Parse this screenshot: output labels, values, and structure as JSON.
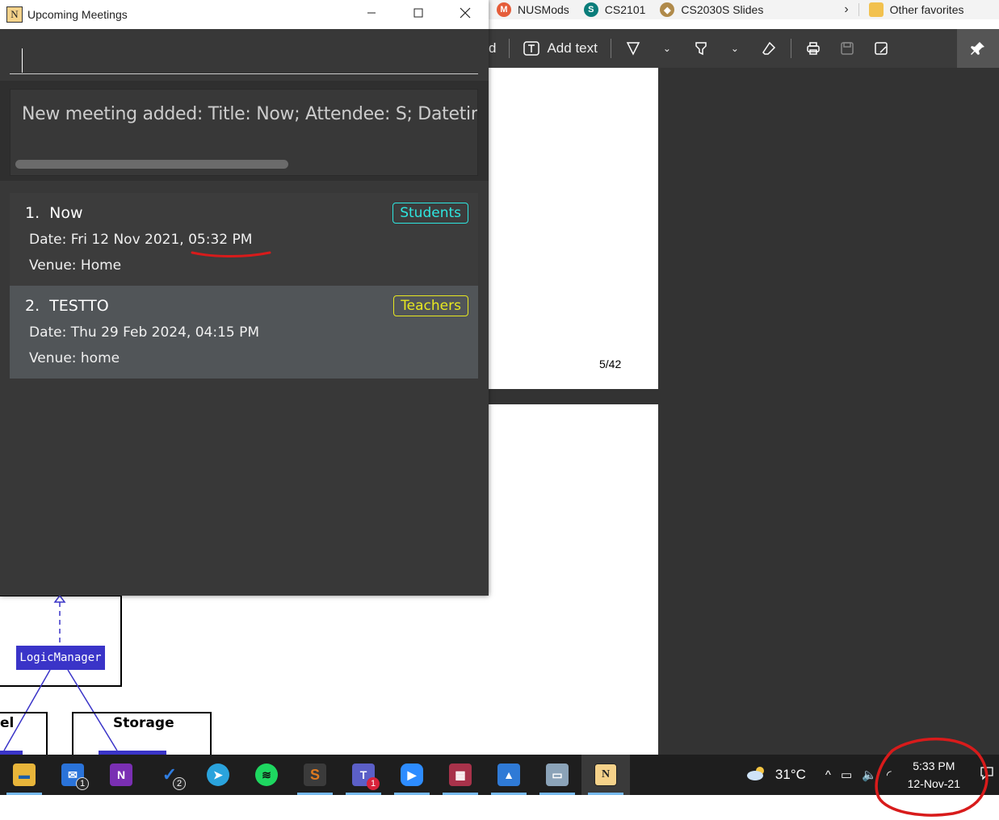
{
  "bookmarks": [
    {
      "label": "NUSMods",
      "icon": "nusmods-icon",
      "color": "#e55d3a",
      "glyph": "M"
    },
    {
      "label": "CS2101",
      "icon": "sharepoint-icon",
      "color": "#0a7d7a",
      "glyph": "S"
    },
    {
      "label": "CS2030S Slides",
      "icon": "github-icon",
      "color": "#b08a4a",
      "glyph": "◆"
    }
  ],
  "bookmarks_more": "Other favorites",
  "pdf_toolbar": {
    "partial_label": "d",
    "add_text_label": "Add text"
  },
  "pdf": {
    "page_number": "5/42"
  },
  "diagram": {
    "logic_manager": "LogicManager",
    "storage": "Storage",
    "model_partial": "el"
  },
  "app": {
    "title": "Upcoming Meetings",
    "app_icon_letter": "N",
    "command_value": "",
    "result_text": "New meeting added: Title: Now; Attendee: S; Datetime: Fri"
  },
  "meetings": [
    {
      "index": "1.",
      "title": "Now",
      "date": "Date: Fri 12 Nov 2021, 05:32 PM",
      "venue": "Venue: Home",
      "tag": "Students"
    },
    {
      "index": "2.",
      "title": "TESTTO",
      "date": "Date: Thu 29 Feb 2024, 04:15 PM",
      "venue": "Venue: home",
      "tag": "Teachers"
    }
  ],
  "taskbar": {
    "apps": [
      {
        "name": "file-explorer-icon",
        "color": "#e8b53a",
        "glyph": "▬",
        "badge": ""
      },
      {
        "name": "mail-icon",
        "color": "#2a73d9",
        "glyph": "✉",
        "badge": "1"
      },
      {
        "name": "onenote-icon",
        "color": "#7a2fb3",
        "glyph": "N",
        "badge": ""
      },
      {
        "name": "todo-icon",
        "color": "#2f7de0",
        "glyph": "✓",
        "badge": "2"
      },
      {
        "name": "telegram-icon",
        "color": "#2aa3dd",
        "glyph": "➤",
        "badge": ""
      },
      {
        "name": "spotify-icon",
        "color": "#1ed760",
        "glyph": "≋",
        "badge": ""
      },
      {
        "name": "sublime-icon",
        "color": "#e07a1f",
        "glyph": "S",
        "badge": ""
      },
      {
        "name": "teams-icon",
        "color": "#5b5fc7",
        "glyph": "T",
        "badge": "1"
      },
      {
        "name": "zoom-icon",
        "color": "#2d8cff",
        "glyph": "▶",
        "badge": ""
      },
      {
        "name": "winrar-icon",
        "color": "#a8324a",
        "glyph": "▦",
        "badge": ""
      },
      {
        "name": "photos-icon",
        "color": "#2f7ad6",
        "glyph": "▲",
        "badge": ""
      },
      {
        "name": "rdp-icon",
        "color": "#8ba3b8",
        "glyph": "▭",
        "badge": ""
      },
      {
        "name": "notuscord-icon",
        "color": "#f5d28a",
        "glyph": "N",
        "badge": ""
      }
    ],
    "weather": "31°C",
    "time": "5:33 PM",
    "date": "12-Nov-21"
  }
}
